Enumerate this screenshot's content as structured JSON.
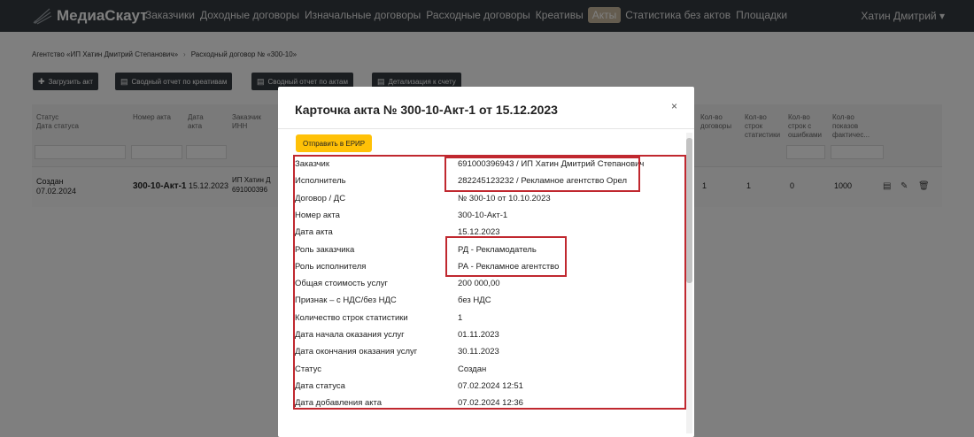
{
  "navbar": {
    "brand": "МедиаСкаут",
    "links": [
      "Заказчики",
      "Доходные договоры",
      "Изначальные договоры",
      "Расходные договоры",
      "Креативы",
      "Акты",
      "Статистика без актов",
      "Площадки"
    ],
    "active_link": "Акты",
    "user": "Хатин Дмитрий ▾"
  },
  "breadcrumb": {
    "item1": "Агентство «ИП Хатин Дмитрий Степанович»",
    "separator": "›",
    "item2": "Расходный договор № «300-10»"
  },
  "toolbar": {
    "upload": "Загрузить акт",
    "report_creatives": "Сводный отчет по креативам",
    "report_acts": "Сводный отчет по актам",
    "details": "Детализация к счету"
  },
  "table": {
    "headers": {
      "status": "Статус",
      "status_date": "Дата статуса",
      "act_number": "Номер акта",
      "act_date_1": "Дата",
      "act_date_2": "акта",
      "customer_1": "Заказчик",
      "customer_2": "ИНН",
      "contracts_1": "Кол-во",
      "contracts_2": "договоры",
      "stat_rows_1": "Кол-во",
      "stat_rows_2": "строк",
      "stat_rows_3": "статистики",
      "err_rows_1": "Кол-во",
      "err_rows_2": "строк с",
      "err_rows_3": "ошибками",
      "shows_1": "Кол-во",
      "shows_2": "показов",
      "shows_3": "фактичес..."
    },
    "row": {
      "status": "Создан",
      "status_date": "07.02.2024",
      "act_number": "300-10-Акт-1",
      "act_date": "15.12.2023",
      "customer_1": "ИП Хатин Д",
      "customer_2": "691000396",
      "contracts": "1",
      "stat_rows": "1",
      "err_rows": "0",
      "shows": "1000"
    }
  },
  "modal": {
    "title": "Карточка акта № 300-10-Акт-1 от 15.12.2023",
    "close": "×",
    "erip_button": "Отправить в ЕРИР",
    "fields": [
      {
        "label": "Заказчик",
        "value": "691000396943 / ИП Хатин Дмитрий Степанович"
      },
      {
        "label": "Исполнитель",
        "value": "282245123232 / Рекламное агентство Орел"
      },
      {
        "label": "Договор / ДС",
        "value": "№ 300-10 от 10.10.2023"
      },
      {
        "label": "Номер акта",
        "value": "300-10-Акт-1"
      },
      {
        "label": "Дата акта",
        "value": "15.12.2023"
      },
      {
        "label": "Роль заказчика",
        "value": "РД - Рекламодатель"
      },
      {
        "label": "Роль исполнителя",
        "value": "РА - Рекламное агентство"
      },
      {
        "label": "Общая стоимость услуг",
        "value": "200 000,00"
      },
      {
        "label": "Признак – с НДС/без НДС",
        "value": "без НДС"
      },
      {
        "label": "Количество строк статистики",
        "value": "1"
      },
      {
        "label": "Дата начала оказания услуг",
        "value": "01.11.2023"
      },
      {
        "label": "Дата окончания оказания услуг",
        "value": "30.11.2023"
      },
      {
        "label": "Статус",
        "value": "Создан"
      },
      {
        "label": "Дата статуса",
        "value": "07.02.2024 12:51"
      },
      {
        "label": "Дата добавления акта",
        "value": "07.02.2024 12:36"
      }
    ]
  },
  "colors": {
    "navbar": "#343a40",
    "accent_yellow": "#ffc107",
    "highlight_red": "#c0282f"
  }
}
